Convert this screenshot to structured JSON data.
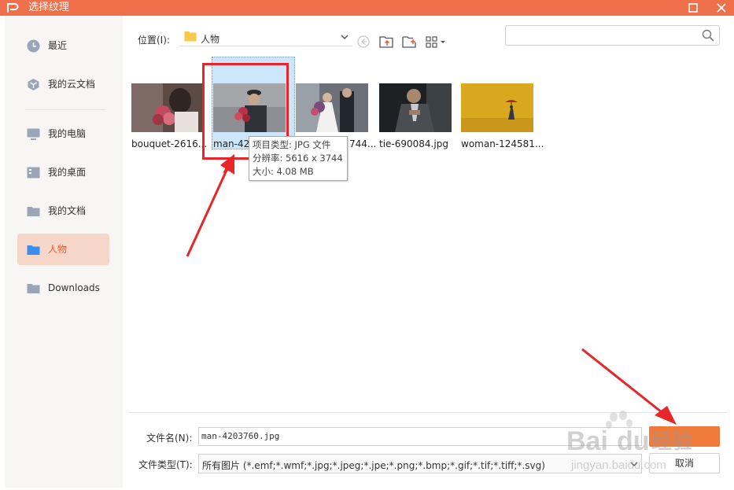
{
  "window": {
    "title": "选择纹理"
  },
  "sidebar": {
    "items": [
      {
        "label": "最近",
        "icon": "clock-icon"
      },
      {
        "label": "我的云文档",
        "icon": "cloud-doc-icon"
      },
      {
        "label": "我的电脑",
        "icon": "computer-icon"
      },
      {
        "label": "我的桌面",
        "icon": "desktop-icon"
      },
      {
        "label": "我的文档",
        "icon": "folder-icon"
      },
      {
        "label": "人物",
        "icon": "folder-icon"
      },
      {
        "label": "Downloads",
        "icon": "folder-icon"
      }
    ],
    "active": "人物"
  },
  "location": {
    "label": "位置(I):",
    "value": "人物"
  },
  "search": {
    "placeholder": ""
  },
  "files": [
    {
      "name": "bouquet-2616...",
      "selected": false
    },
    {
      "name": "man-420",
      "selected": true
    },
    {
      "name": "744...",
      "selected": false
    },
    {
      "name": "tie-690084.jpg",
      "selected": false
    },
    {
      "name": "woman-124581...",
      "selected": false
    }
  ],
  "tooltip": {
    "type_line": "项目类型: JPG 文件",
    "resolution_line": "分辨率: 5616 x 3744",
    "size_line": "大小: 4.08 MB"
  },
  "footer": {
    "filename_label": "文件名(N):",
    "filename_value": "man-4203760.jpg",
    "filetype_label": "文件类型(T):",
    "filetype_value": "所有图片 (*.emf;*.wmf;*.jpg;*.jpeg;*.jpe;*.png;*.bmp;*.gif;*.tif;*.tiff;*.svg)",
    "open_label": "",
    "cancel_label": "取消"
  },
  "watermark": {
    "brand": "Baidu经验",
    "url": "jingyan.baidu.com"
  },
  "colors": {
    "accent": "#f0704b",
    "active_nav_bg": "#f5d6c8",
    "selection": "#cce6fb",
    "annotation_red": "#e8262a"
  }
}
